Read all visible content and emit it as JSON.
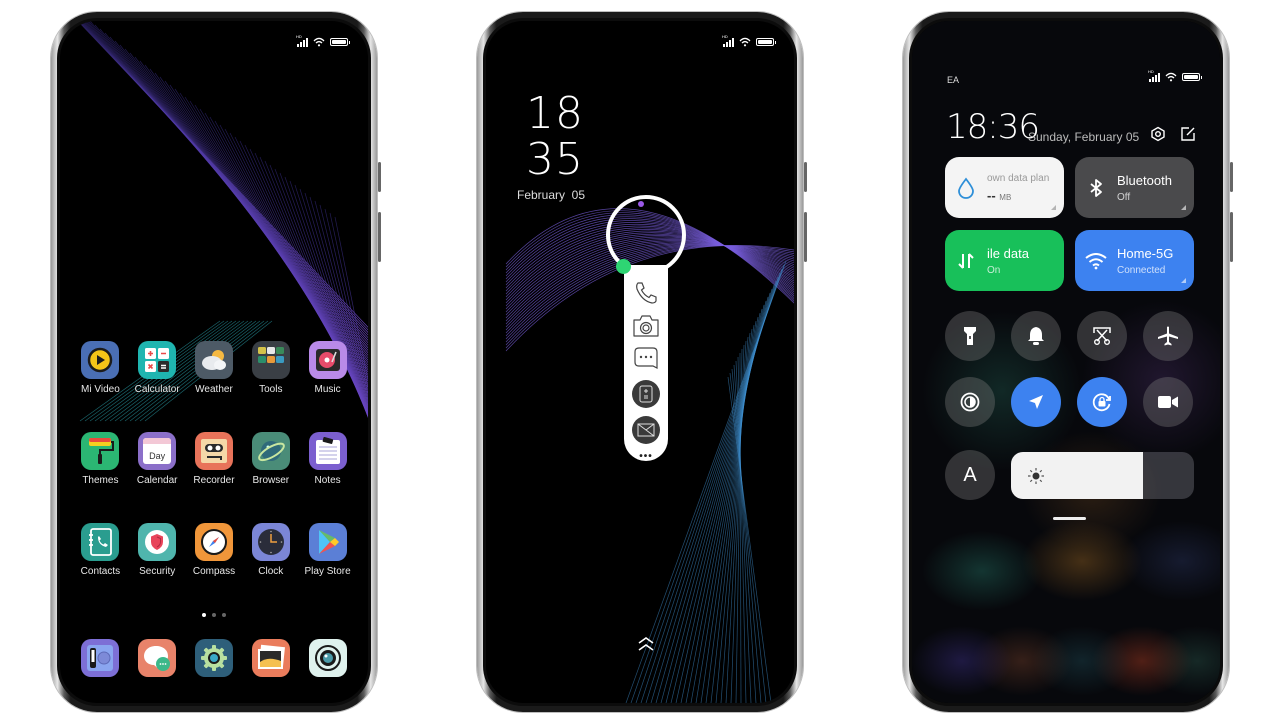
{
  "status_bar": {
    "network": "HD",
    "signal_bars": 4,
    "wifi": true,
    "battery_level": 1.0
  },
  "home_screen": {
    "rows": [
      [
        {
          "label": "Mi Video",
          "icon": "play-icon",
          "color": "#4a6fb5"
        },
        {
          "label": "Calculator",
          "icon": "calculator-icon",
          "color": "#1fb5b0"
        },
        {
          "label": "Weather",
          "icon": "cloud-sun-icon",
          "color": "#4d5a66"
        },
        {
          "label": "Tools",
          "icon": "folder-grid-icon",
          "color": "#3a3f45"
        },
        {
          "label": "Music",
          "icon": "vinyl-icon",
          "color": "#b98ae8"
        }
      ],
      [
        {
          "label": "Themes",
          "icon": "paint-roller-icon",
          "color": "#2bb673"
        },
        {
          "label": "Calendar",
          "icon": "calendar-icon",
          "color": "#8b6fc9",
          "icon_text": "Day"
        },
        {
          "label": "Recorder",
          "icon": "cassette-icon",
          "color": "#e8735a"
        },
        {
          "label": "Browser",
          "icon": "planet-icon",
          "color": "#4a8c78"
        },
        {
          "label": "Notes",
          "icon": "notepad-icon",
          "color": "#7b5fcf"
        }
      ],
      [
        {
          "label": "Contacts",
          "icon": "contacts-book-icon",
          "color": "#2a9d8f"
        },
        {
          "label": "Security",
          "icon": "shield-icon",
          "color": "#4fb5ad"
        },
        {
          "label": "Compass",
          "icon": "compass-icon",
          "color": "#f0963a"
        },
        {
          "label": "Clock",
          "icon": "clock-icon",
          "color": "#7b86d6"
        },
        {
          "label": "Play Store",
          "icon": "play-store-icon",
          "color": "#5b7fd6"
        }
      ]
    ],
    "page_indicator": {
      "pages": 3,
      "current": 1
    },
    "dock": [
      {
        "name": "phone-dialer",
        "icon": "dialer-icon",
        "color": "#7d6fd6"
      },
      {
        "name": "messages",
        "icon": "chat-bubble-icon",
        "color": "#e8836a"
      },
      {
        "name": "settings",
        "icon": "gear-icon",
        "color": "#2e5f7a"
      },
      {
        "name": "gallery",
        "icon": "gallery-icon",
        "color": "#ea7c5c"
      },
      {
        "name": "camera",
        "icon": "camera-lens-icon",
        "color": "#dff2ee"
      }
    ]
  },
  "lock_screen": {
    "hour": "18",
    "minute": "35",
    "date": "February  05",
    "shortcuts": [
      {
        "name": "phone",
        "icon": "phone-icon"
      },
      {
        "name": "camera",
        "icon": "camera-icon"
      },
      {
        "name": "messages",
        "icon": "message-icon"
      },
      {
        "name": "calculator",
        "icon": "calculator-icon"
      },
      {
        "name": "mail",
        "icon": "mail-icon"
      }
    ],
    "more_label": "•••",
    "swipe_hint": "swipe-up"
  },
  "control_center": {
    "carrier": "EA",
    "time": "18:36",
    "date": "Sunday, February 05",
    "tiles": [
      {
        "name": "data-plan",
        "title": "own data plan",
        "value": "--",
        "unit": "MB",
        "icon": "water-drop-icon",
        "bg": "#f4f4f4",
        "fg": "#333333"
      },
      {
        "name": "bluetooth",
        "title": "Bluetooth",
        "sub": "Off",
        "icon": "bluetooth-icon",
        "bg": "#4a4a4c",
        "fg": "#ffffff"
      },
      {
        "name": "mobile-data",
        "title": "ile data",
        "sub": "On",
        "icon": "data-arrows-icon",
        "bg": "#18c05a",
        "fg": "#ffffff"
      },
      {
        "name": "wifi",
        "title": "Home-5G",
        "sub": "Connected",
        "icon": "wifi-icon",
        "bg": "#3d82f0",
        "fg": "#ffffff"
      }
    ],
    "toggles": [
      {
        "name": "flashlight",
        "icon": "flashlight-icon",
        "on": false
      },
      {
        "name": "ringer",
        "icon": "bell-icon",
        "on": false
      },
      {
        "name": "screenshot",
        "icon": "scissors-icon",
        "on": false
      },
      {
        "name": "airplane-mode",
        "icon": "airplane-icon",
        "on": false
      },
      {
        "name": "dark-mode",
        "icon": "contrast-icon",
        "on": false
      },
      {
        "name": "location",
        "icon": "location-arrow-icon",
        "on": true
      },
      {
        "name": "rotation-lock",
        "icon": "rotation-lock-icon",
        "on": true
      },
      {
        "name": "screen-recorder",
        "icon": "video-camera-icon",
        "on": false
      }
    ],
    "auto_brightness_label": "A",
    "brightness_level": 0.72
  }
}
